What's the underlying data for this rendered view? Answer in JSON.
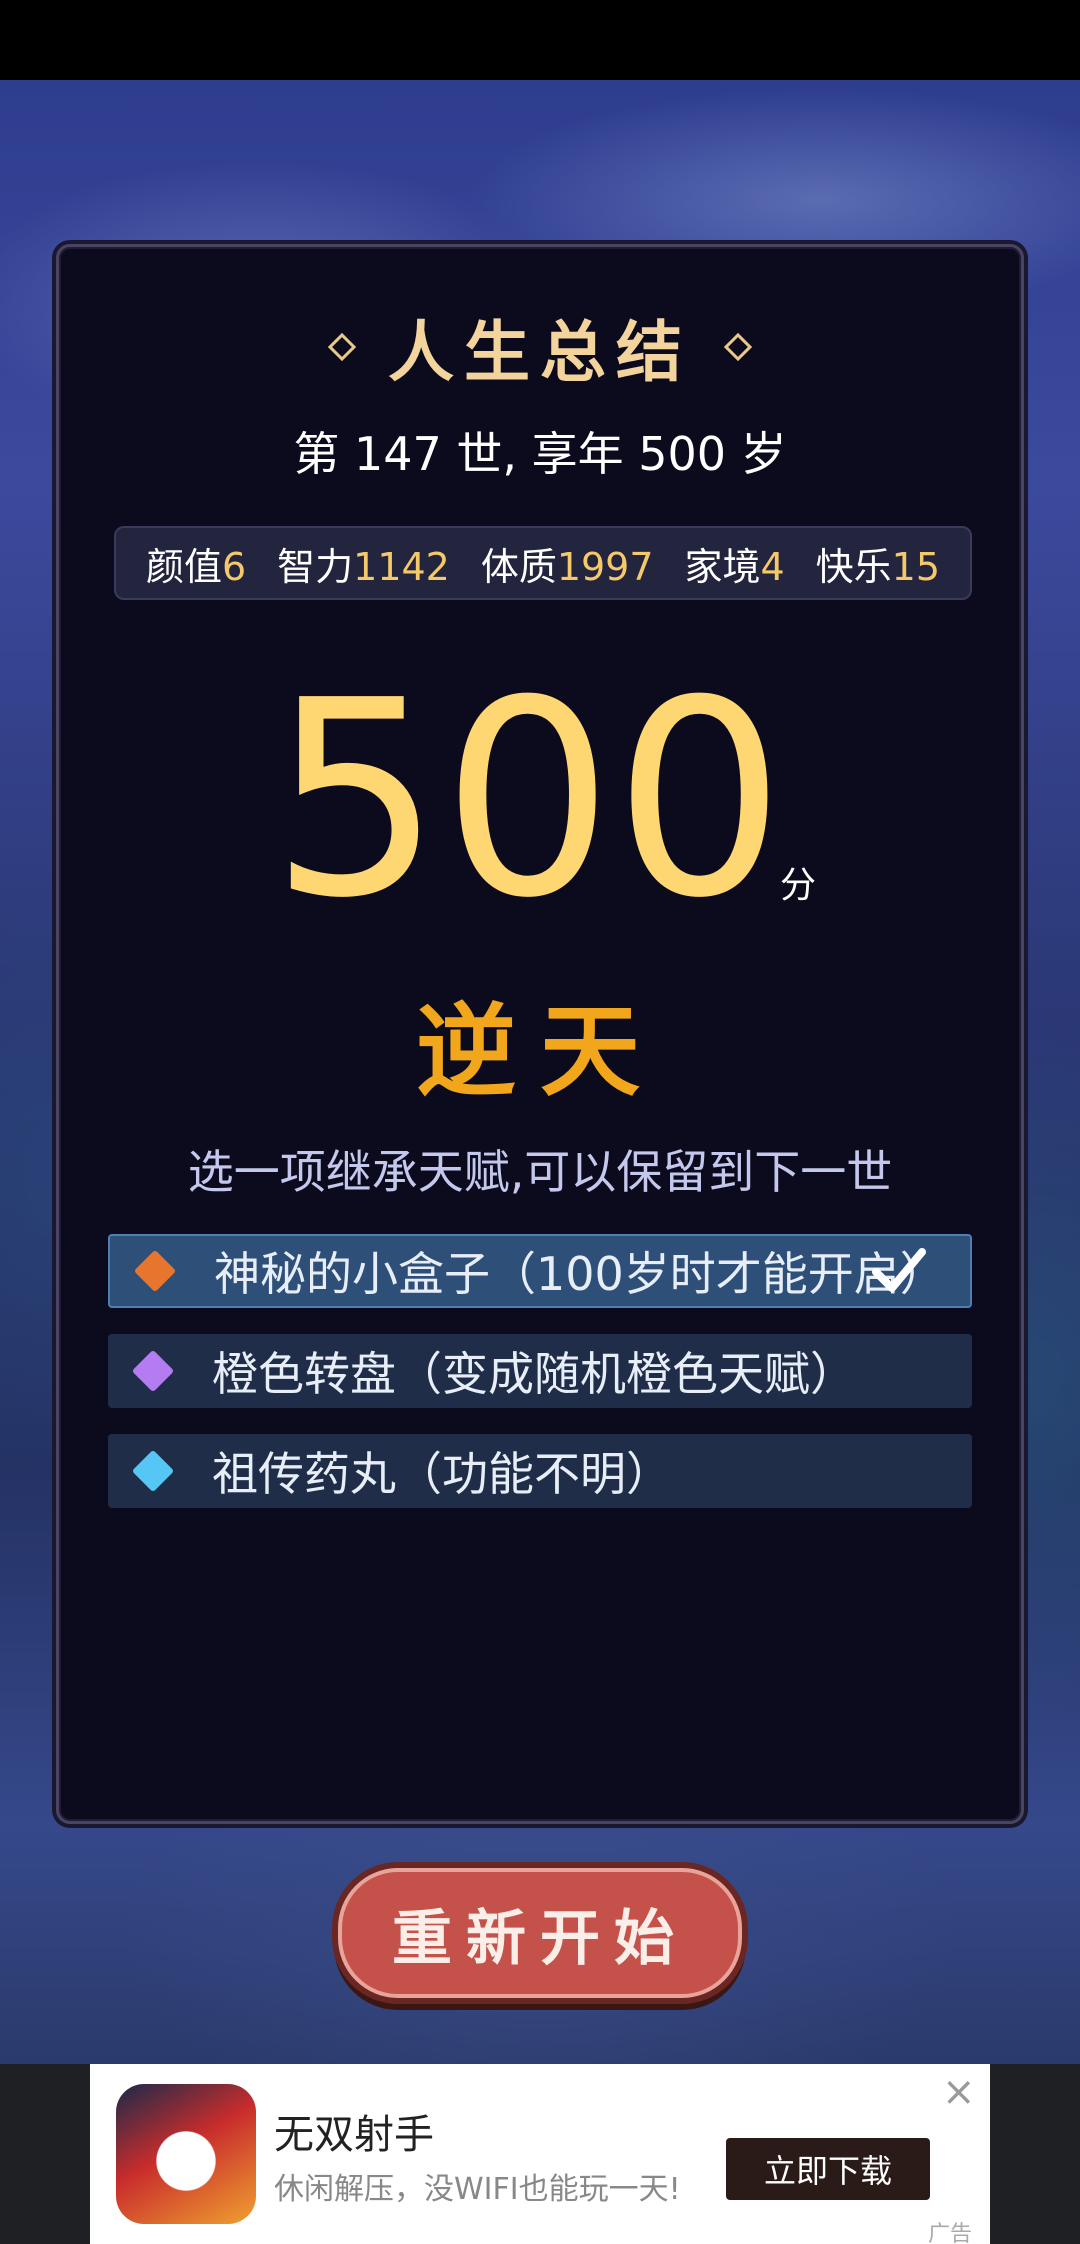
{
  "summary": {
    "title": "人生总结",
    "life_line": "第 147 世, 享年 500 岁"
  },
  "stats": [
    {
      "label": "颜值",
      "value": "6"
    },
    {
      "label": "智力",
      "value": "1142"
    },
    {
      "label": "体质",
      "value": "1997"
    },
    {
      "label": "家境",
      "value": "4"
    },
    {
      "label": "快乐",
      "value": "15"
    }
  ],
  "score": {
    "value": "500",
    "unit": "分",
    "rank": "逆天"
  },
  "inherit": {
    "prompt": "选一项继承天赋,可以保留到下一世",
    "options": [
      {
        "label": "神秘的小盒子（100岁时才能开启）",
        "gem": "orange-diamond-icon",
        "color": "#e8752d",
        "selected": true
      },
      {
        "label": "橙色转盘（变成随机橙色天赋）",
        "gem": "purple-diamond-icon",
        "color": "#b57cf2",
        "selected": false
      },
      {
        "label": "祖传药丸（功能不明）",
        "gem": "cyan-diamond-icon",
        "color": "#56c6f4",
        "selected": false
      }
    ]
  },
  "restart_button": "重新开始",
  "ad": {
    "title": "无双射手",
    "subtitle": "休闲解压，没WIFI也能玩一天!",
    "button": "立即下载",
    "tag": "广告",
    "close": "×"
  },
  "colors": {
    "accent_gold": "#ffd772",
    "rank_orange": "#f2a61c",
    "panel": "#0c0b1e",
    "button_red": "#c4524b"
  }
}
